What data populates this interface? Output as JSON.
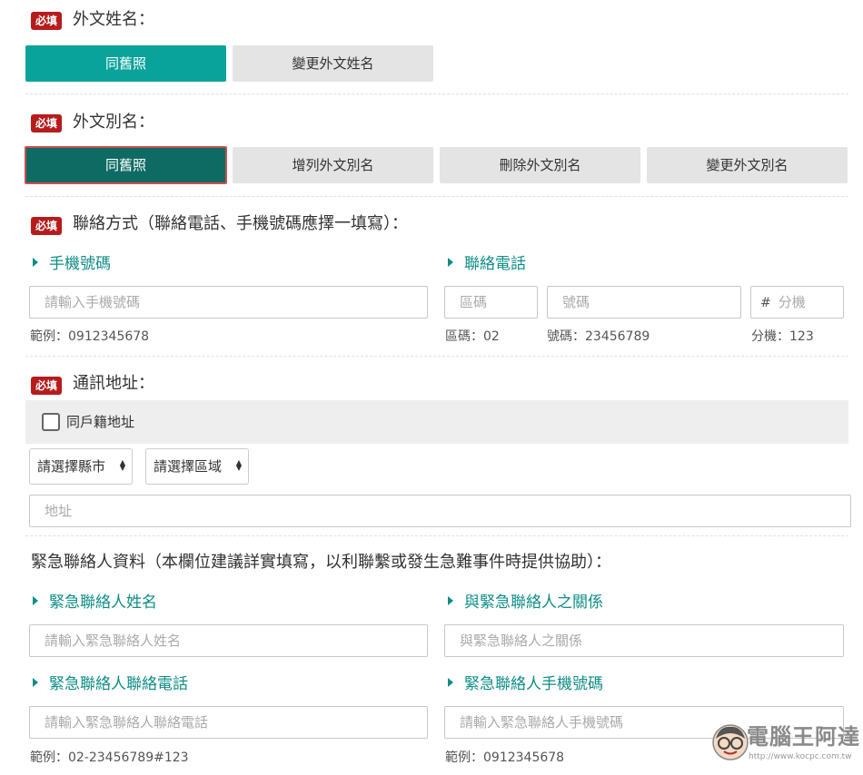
{
  "foreign_name": {
    "required_badge": "必填",
    "title": "外文姓名：",
    "buttons": [
      "同舊照",
      "變更外文姓名"
    ]
  },
  "foreign_alias": {
    "required_badge": "必填",
    "title": "外文別名：",
    "buttons": [
      "同舊照",
      "增列外文別名",
      "刪除外文別名",
      "變更外文別名"
    ]
  },
  "contact": {
    "required_badge": "必填",
    "title": "聯絡方式（聯絡電話、手機號碼應擇一填寫）：",
    "mobile": {
      "label": "手機號碼",
      "placeholder": "請輸入手機號碼",
      "hint": "範例：0912345678"
    },
    "phone": {
      "label": "聯絡電話",
      "area_placeholder": "區碼",
      "number_placeholder": "號碼",
      "ext_prefix": "#",
      "ext_placeholder": "分機",
      "area_hint": "區碼：02",
      "number_hint": "號碼：23456789",
      "ext_hint": "分機：123"
    }
  },
  "address": {
    "required_badge": "必填",
    "title": "通訊地址：",
    "same_as_household_label": "同戶籍地址",
    "city_select": "請選擇縣市",
    "district_select": "請選擇區域",
    "address_placeholder": "地址"
  },
  "emergency": {
    "title": "緊急聯絡人資料（本欄位建議詳實填寫，以利聯繫或發生急難事件時提供協助）：",
    "name": {
      "label": "緊急聯絡人姓名",
      "placeholder": "請輸入緊急聯絡人姓名"
    },
    "relation": {
      "label": "與緊急聯絡人之關係",
      "placeholder": "與緊急聯絡人之關係"
    },
    "phone": {
      "label": "緊急聯絡人聯絡電話",
      "placeholder": "請輸入緊急聯絡人聯絡電話",
      "hint": "範例：02-23456789#123"
    },
    "mobile": {
      "label": "緊急聯絡人手機號碼",
      "placeholder": "請輸入緊急聯絡人手機號碼",
      "hint": "範例：0912345678"
    }
  },
  "watermark": {
    "brand": "電腦王阿達",
    "url": "http://www.kocpc.com.tw"
  },
  "colors": {
    "accent": "#0aa39b",
    "accent_dark": "#0e6b64",
    "required": "#b71c1c",
    "label": "#0e8d85"
  }
}
